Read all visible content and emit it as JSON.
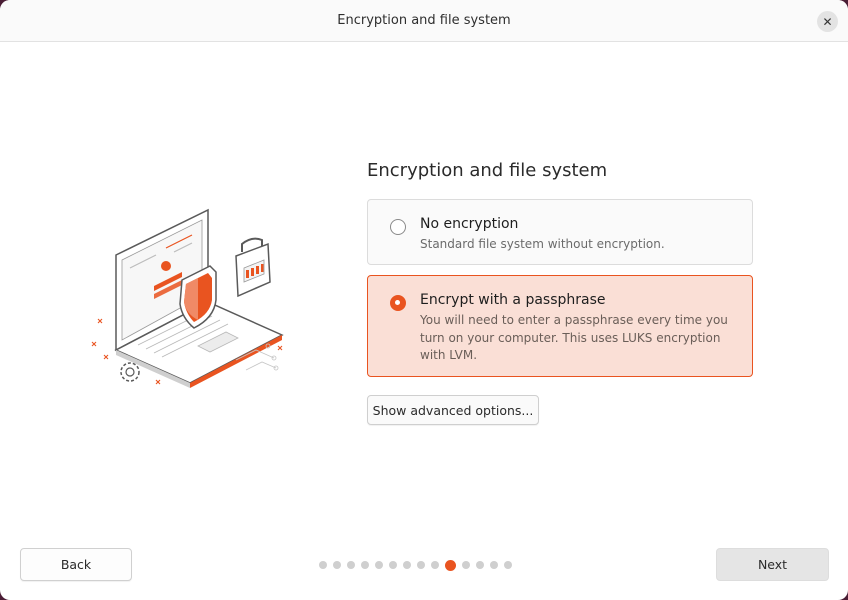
{
  "window": {
    "title": "Encryption and file system",
    "close_icon": "close-icon"
  },
  "illustration": {
    "icon": "laptop-shield-lock-illustration"
  },
  "main": {
    "heading": "Encryption and file system",
    "options": [
      {
        "label": "No encryption",
        "description": "Standard file system without encryption.",
        "selected": false
      },
      {
        "label": "Encrypt with a passphrase",
        "description": "You will need to enter a passphrase every time you turn on your computer. This uses LUKS encryption with LVM.",
        "selected": true
      }
    ],
    "advanced_button": "Show advanced options..."
  },
  "footer": {
    "back_label": "Back",
    "next_label": "Next",
    "pager": {
      "total_steps": 14,
      "current_step": 10
    }
  },
  "colors": {
    "accent": "#e95420",
    "selected_bg": "#fadfd6"
  }
}
